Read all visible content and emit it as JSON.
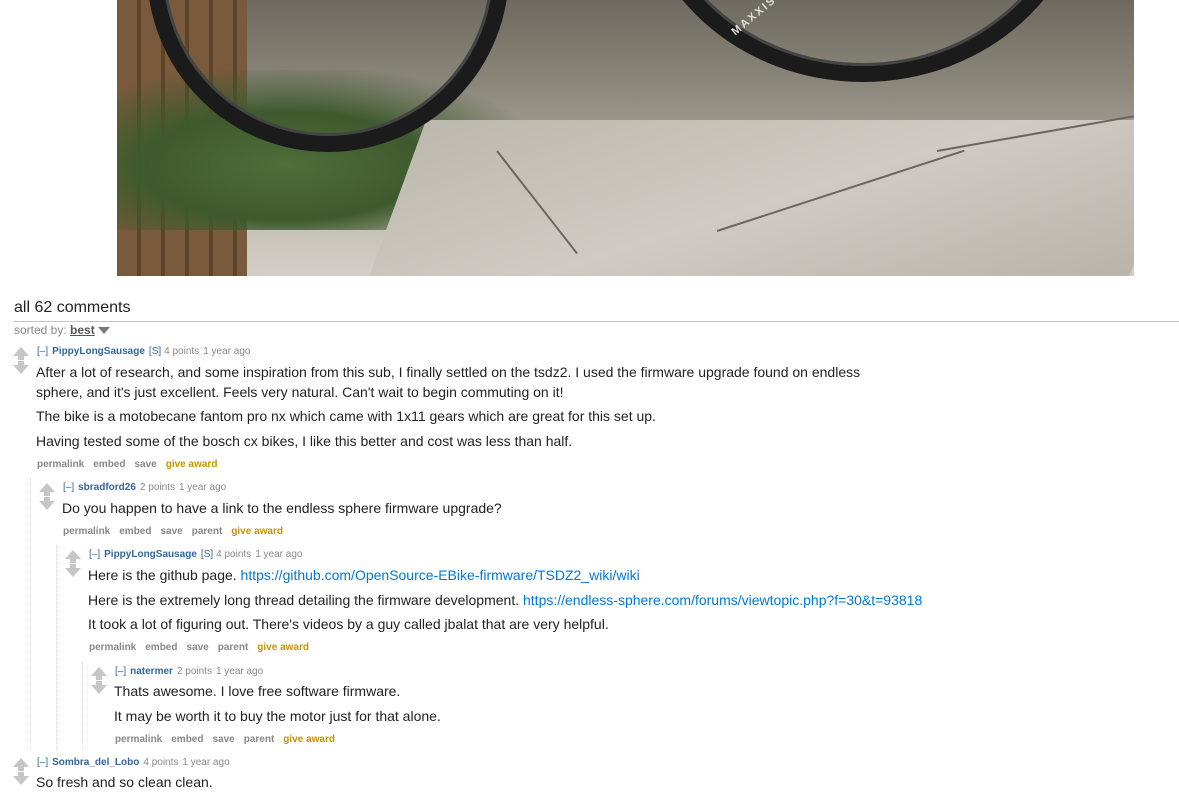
{
  "post_image": {
    "tire_brand": "MAXXIS"
  },
  "comments_section": {
    "count_label": "all 62 comments",
    "sorted_by_label": "sorted by:",
    "sort_value": "best"
  },
  "comments": [
    {
      "expand": "[–]",
      "author": "PippyLongSausage",
      "submitter_tag": "[S]",
      "score": "4 points",
      "time": "1 year ago",
      "paragraphs": [
        "After a lot of research, and some inspiration from this sub, I finally settled on the tsdz2. I used the firmware upgrade found on endless",
        "sphere, and it's just excellent. Feels very natural. Can't wait to begin commuting on it!",
        "The bike is a motobecane fantom pro nx which came with 1x11 gears which are great for this set up.",
        "Having tested some of the bosch cx bikes, I like this better and cost was less than half."
      ],
      "buttons": [
        "permalink",
        "embed",
        "save",
        "give award"
      ]
    },
    {
      "expand": "[–]",
      "author": "sbradford26",
      "score": "2 points",
      "time": "1 year ago",
      "paragraphs": [
        "Do you happen to have a link to the endless sphere firmware upgrade?"
      ],
      "buttons": [
        "permalink",
        "embed",
        "save",
        "parent",
        "give award"
      ]
    },
    {
      "expand": "[–]",
      "author": "PippyLongSausage",
      "submitter_tag": "[S]",
      "score": "4 points",
      "time": "1 year ago",
      "paragraphs": [
        {
          "text": "Here is the github page. ",
          "link": "https://github.com/OpenSource-EBike-firmware/TSDZ2_wiki/wiki"
        },
        {
          "text": "Here is the extremely long thread detailing the firmware development. ",
          "link": "https://endless-sphere.com/forums/viewtopic.php?f=30&t=93818"
        },
        {
          "text": "It took a lot of figuring out. There's videos by a guy called jbalat that are very helpful."
        }
      ],
      "buttons": [
        "permalink",
        "embed",
        "save",
        "parent",
        "give award"
      ]
    },
    {
      "expand": "[–]",
      "author": "natermer",
      "score": "2 points",
      "time": "1 year ago",
      "paragraphs": [
        "Thats awesome. I love free software firmware.",
        "It may be worth it to buy the motor just for that alone."
      ],
      "buttons": [
        "permalink",
        "embed",
        "save",
        "parent",
        "give award"
      ]
    },
    {
      "expand": "[–]",
      "author": "Sombra_del_Lobo",
      "score": "4 points",
      "time": "1 year ago",
      "paragraphs": [
        "So fresh and so clean clean."
      ]
    }
  ],
  "colors": {
    "author_link": "#336699",
    "body_link": "#0079d3",
    "award": "#c29600",
    "meta_text": "#888888"
  }
}
